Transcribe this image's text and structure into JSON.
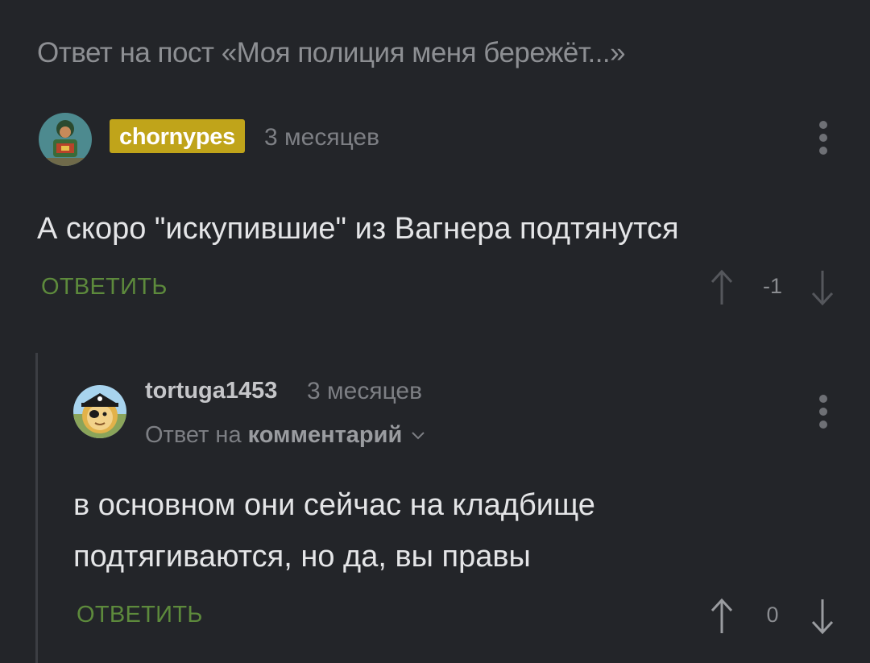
{
  "post": {
    "reply_header": "Ответ на пост «Моя полиция меня бережёт...»"
  },
  "comments": [
    {
      "username": "chornypes",
      "time": "3 месяцев",
      "text": "А скоро \"искупившие\" из Вагнера подтянутся",
      "reply_label": "ОТВЕТИТЬ",
      "rating": "-1"
    },
    {
      "username": "tortuga1453",
      "time": "3 месяцев",
      "reply_prefix": "Ответ на",
      "reply_target": "комментарий",
      "text_line1": "в основном они сейчас на кладбище",
      "text_line2": "подтягиваются, но да, вы правы",
      "reply_label": "ОТВЕТИТЬ",
      "rating": "0"
    }
  ],
  "colors": {
    "background": "#232529",
    "author_badge": "#c0a41a",
    "reply_link": "#5d8a3c",
    "text": "#e4e5e7"
  }
}
